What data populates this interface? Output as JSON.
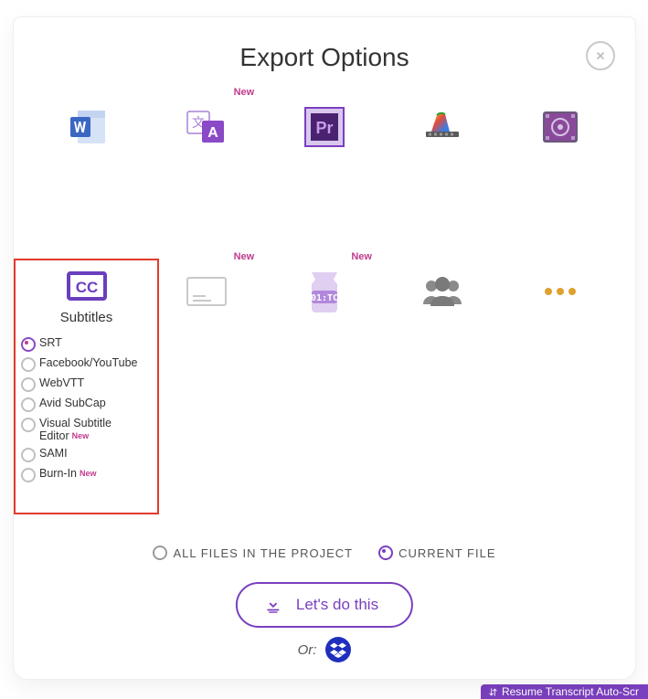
{
  "title": "Export Options",
  "badges": {
    "new": "New"
  },
  "tiles_row1": [
    {
      "name": "word"
    },
    {
      "name": "translate",
      "new": true
    },
    {
      "name": "premiere"
    },
    {
      "name": "finalcut"
    },
    {
      "name": "avid"
    }
  ],
  "tiles_row2": [
    {
      "name": "subtitles"
    },
    {
      "name": "plaintext",
      "new": true
    },
    {
      "name": "timecode",
      "new": true
    },
    {
      "name": "speakers"
    },
    {
      "name": "more"
    }
  ],
  "subtitles": {
    "title": "Subtitles",
    "options": [
      {
        "label": "SRT",
        "sel": true
      },
      {
        "label": "Facebook/YouTube"
      },
      {
        "label": "WebVTT"
      },
      {
        "label": "Avid SubCap"
      },
      {
        "label": "Visual Subtitle Editor",
        "new": true
      },
      {
        "label": "SAMI"
      },
      {
        "label": "Burn-In",
        "new": true
      }
    ]
  },
  "scope": {
    "all": "ALL FILES IN THE PROJECT",
    "current": "CURRENT FILE",
    "selected": "current"
  },
  "cta": "Let's do this",
  "or": "Or:",
  "footer": {
    "resume": "Resume Transcript Auto-Scr"
  }
}
